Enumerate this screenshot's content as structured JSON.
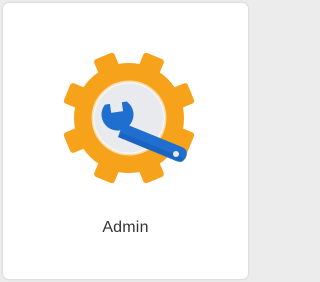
{
  "tile": {
    "label": "Admin",
    "icon": "admin-settings-icon"
  },
  "colors": {
    "gear": "#f7a21b",
    "gear_inner": "#e9eaee",
    "wrench": "#1f6fd1",
    "wrench_shadow": "#1a5ab0",
    "label_text": "#333333"
  }
}
